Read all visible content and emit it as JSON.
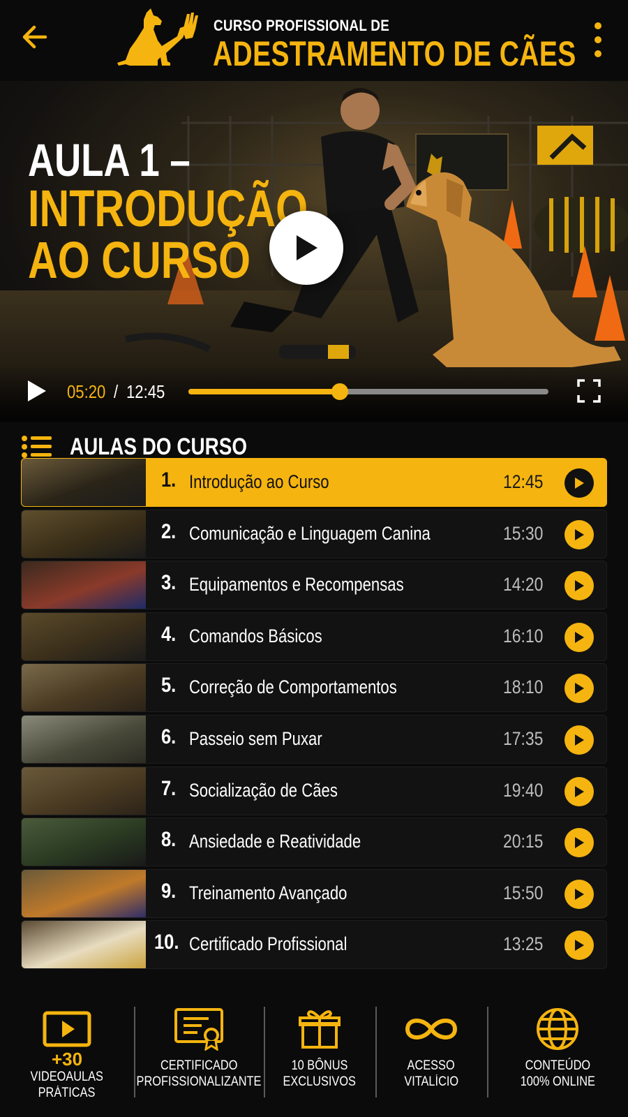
{
  "header": {
    "kicker": "CURSO PROFISSIONAL DE",
    "title": "ADESTRAMENTO DE CÃES",
    "back_icon": "arrow-left-icon",
    "menu_icon": "more-vertical-icon",
    "accent": "#f5b40f"
  },
  "video": {
    "title_line1": "AULA 1 –",
    "title_line2": "INTRODUÇÃO",
    "title_line3": "AO CURSO",
    "current_time": "05:20",
    "separator": "/",
    "total_time": "12:45",
    "progress_fraction": 0.42
  },
  "lessons": {
    "heading": "AULAS DO CURSO",
    "items": [
      {
        "num": "1.",
        "title": "Introdução ao Curso",
        "duration": "12:45",
        "active": true
      },
      {
        "num": "2.",
        "title": "Comunicação e Linguagem Canina",
        "duration": "15:30",
        "active": false
      },
      {
        "num": "3.",
        "title": "Equipamentos e Recompensas",
        "duration": "14:20",
        "active": false
      },
      {
        "num": "4.",
        "title": "Comandos Básicos",
        "duration": "16:10",
        "active": false
      },
      {
        "num": "5.",
        "title": "Correção de Comportamentos",
        "duration": "18:10",
        "active": false
      },
      {
        "num": "6.",
        "title": "Passeio sem Puxar",
        "duration": "17:35",
        "active": false
      },
      {
        "num": "7.",
        "title": "Socialização de Cães",
        "duration": "19:40",
        "active": false
      },
      {
        "num": "8.",
        "title": "Ansiedade e Reatividade",
        "duration": "20:15",
        "active": false
      },
      {
        "num": "9.",
        "title": "Treinamento Avançado",
        "duration": "15:50",
        "active": false
      },
      {
        "num": "10.",
        "title": "Certificado Profissional",
        "duration": "13:25",
        "active": false
      }
    ]
  },
  "features": [
    {
      "icon": "video-play-icon",
      "count": "+30",
      "line1": "VIDEOAULAS",
      "line2": "PRÁTICAS"
    },
    {
      "icon": "certificate-icon",
      "count": "",
      "line1": "CERTIFICADO",
      "line2": "PROFISSIONALIZANTE"
    },
    {
      "icon": "gift-icon",
      "count": "",
      "line1": "10 BÔNUS",
      "line2": "EXCLUSIVOS"
    },
    {
      "icon": "infinity-icon",
      "count": "",
      "line1": "ACESSO",
      "line2": "VITALÍCIO"
    },
    {
      "icon": "globe-icon",
      "count": "",
      "line1": "CONTEÚDO",
      "line2": "100% ONLINE"
    }
  ]
}
